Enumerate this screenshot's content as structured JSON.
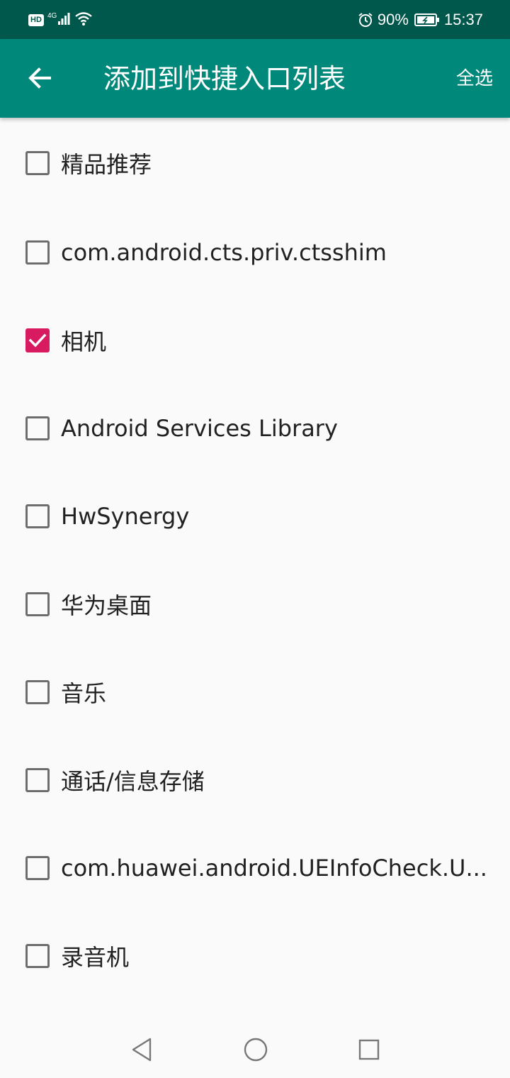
{
  "status_bar": {
    "hd": "HD",
    "network": "4G",
    "battery_percent": "90%",
    "time": "15:37"
  },
  "app_bar": {
    "title": "添加到快捷入口列表",
    "select_all": "全选",
    "color": "#00897b",
    "status_color": "#00574b"
  },
  "list": {
    "items": [
      {
        "label": "精品推荐",
        "checked": false
      },
      {
        "label": "com.android.cts.priv.ctsshim",
        "checked": false
      },
      {
        "label": "相机",
        "checked": true
      },
      {
        "label": "Android Services Library",
        "checked": false
      },
      {
        "label": "HwSynergy",
        "checked": false
      },
      {
        "label": "华为桌面",
        "checked": false
      },
      {
        "label": "音乐",
        "checked": false
      },
      {
        "label": "通话/信息存储",
        "checked": false
      },
      {
        "label": "com.huawei.android.UEInfoCheck.U...",
        "checked": false
      },
      {
        "label": "录音机",
        "checked": false
      }
    ],
    "checked_color": "#d81b60"
  },
  "nav_bar": {
    "icons": [
      "back-triangle-icon",
      "home-circle-icon",
      "recents-square-icon"
    ]
  }
}
